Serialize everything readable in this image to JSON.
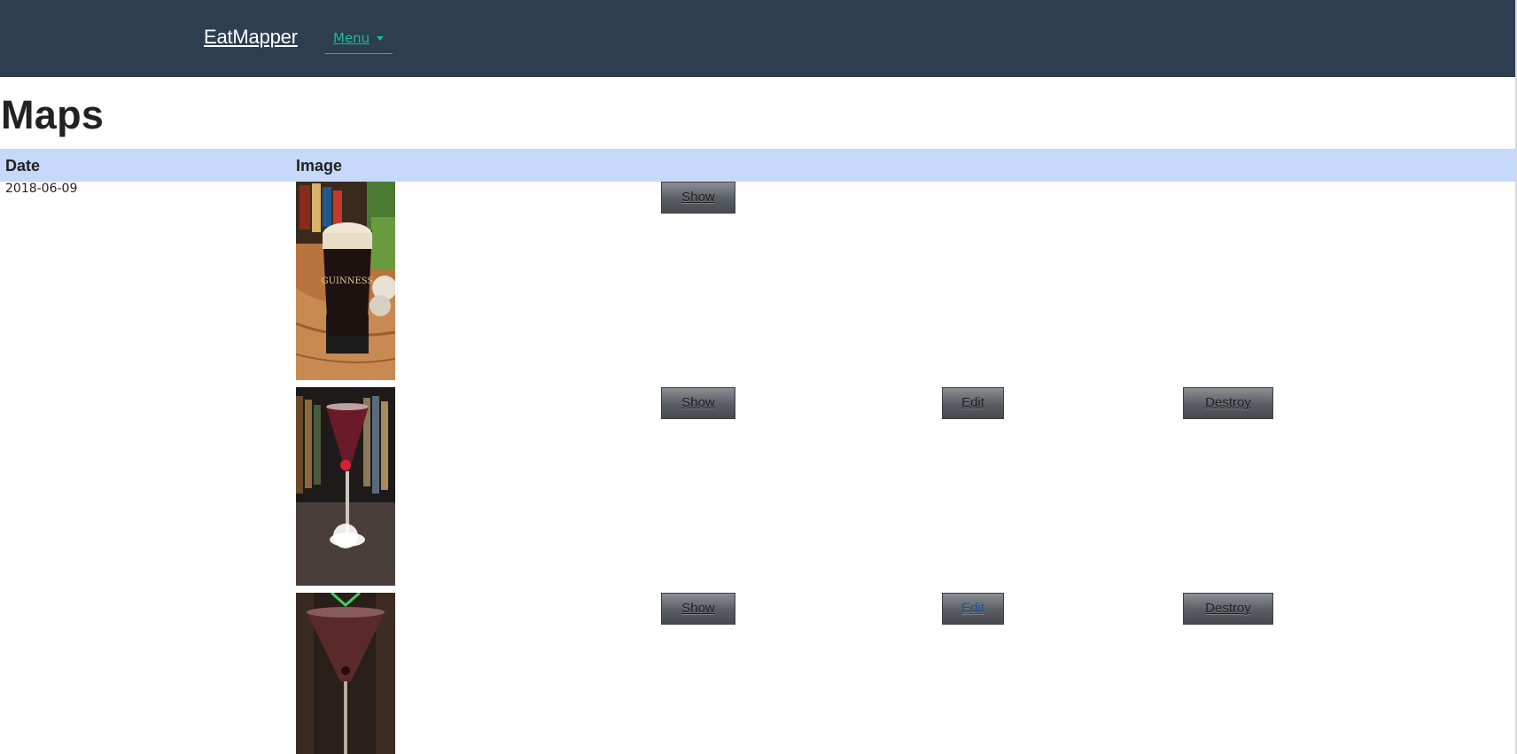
{
  "navbar": {
    "brand": "EatMapper",
    "menu_label": "Menu"
  },
  "page": {
    "title": "Maps"
  },
  "table": {
    "columns": [
      "Date",
      "Image"
    ],
    "rows": [
      {
        "date": "2018-06-09",
        "image_alt": "Guinness pint glass",
        "actions": {
          "show": "Show"
        }
      },
      {
        "date": "",
        "image_alt": "Red cocktail in tall glass",
        "actions": {
          "show": "Show",
          "edit": "Edit",
          "destroy": "Destroy"
        }
      },
      {
        "date": "",
        "image_alt": "Dark cocktail in martini glass",
        "actions": {
          "show": "Show",
          "edit": "Edit",
          "destroy": "Destroy"
        }
      }
    ]
  },
  "colors": {
    "navbar_bg": "#2c3e50",
    "accent": "#18bc9c",
    "table_head_bg": "#c6d9fb"
  }
}
